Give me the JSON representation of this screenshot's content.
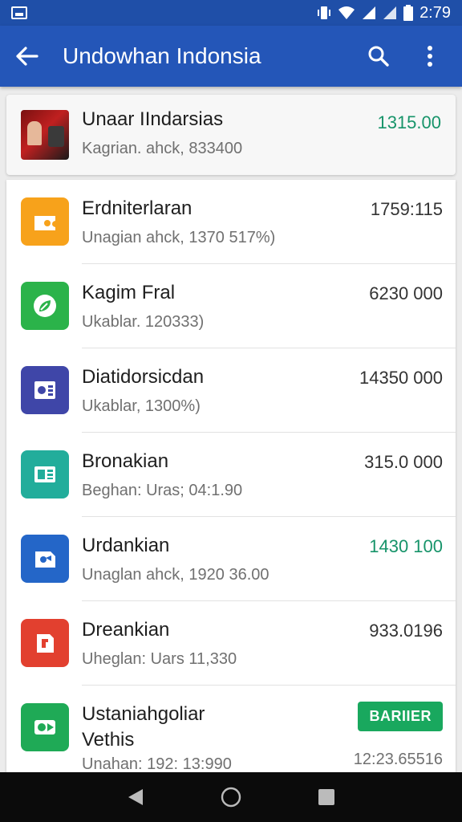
{
  "status_bar": {
    "time": "2:79"
  },
  "app_bar": {
    "title": "Undowhan Indonsia"
  },
  "featured": {
    "title": "Unaar IIndarsias",
    "subtitle": "Kagrian. ahck, 833400",
    "amount": "1315.00"
  },
  "items": [
    {
      "title": "Erdniterlaran",
      "subtitle": "Unagian ahck, 1370 517%)",
      "amount": "1759:115",
      "amount_color": "#333333",
      "icon": "ticket-icon",
      "icon_bg": "#f7a21b"
    },
    {
      "title": "Kagim Fral",
      "subtitle": "Ukablar. 120333)",
      "amount": "6230 000",
      "amount_color": "#333333",
      "icon": "leaf-icon",
      "icon_bg": "#2bb34a"
    },
    {
      "title": "Diatidorsicdan",
      "subtitle": "Ukablar, 1300%)",
      "amount": "14350 000",
      "amount_color": "#333333",
      "icon": "document-icon",
      "icon_bg": "#3f46a8"
    },
    {
      "title": "Bronakian",
      "subtitle": "Beghan: Uras; 04:1.90",
      "amount": "315.0 000",
      "amount_color": "#333333",
      "icon": "card-icon",
      "icon_bg": "#22ad9b"
    },
    {
      "title": "Urdankian",
      "subtitle": "Unaglan ahck, 1920 36.00",
      "amount": "1430 100",
      "amount_color": "#17946a",
      "icon": "tag-icon",
      "icon_bg": "#2466c8"
    },
    {
      "title": "Dreankian",
      "subtitle": "Uheglan: Uars 11,330",
      "amount": "933.0196",
      "amount_color": "#333333",
      "icon": "bookmark-icon",
      "icon_bg": "#e2402f"
    }
  ],
  "last_item": {
    "title_line1": "Ustaniahgoliar",
    "title_line2": "Vethis",
    "subtitle": "Unahan: 192: 13:990",
    "badge": "BARIIER",
    "amount": "12:23.65516",
    "icon": "video-icon",
    "icon_bg": "#1faa56"
  }
}
